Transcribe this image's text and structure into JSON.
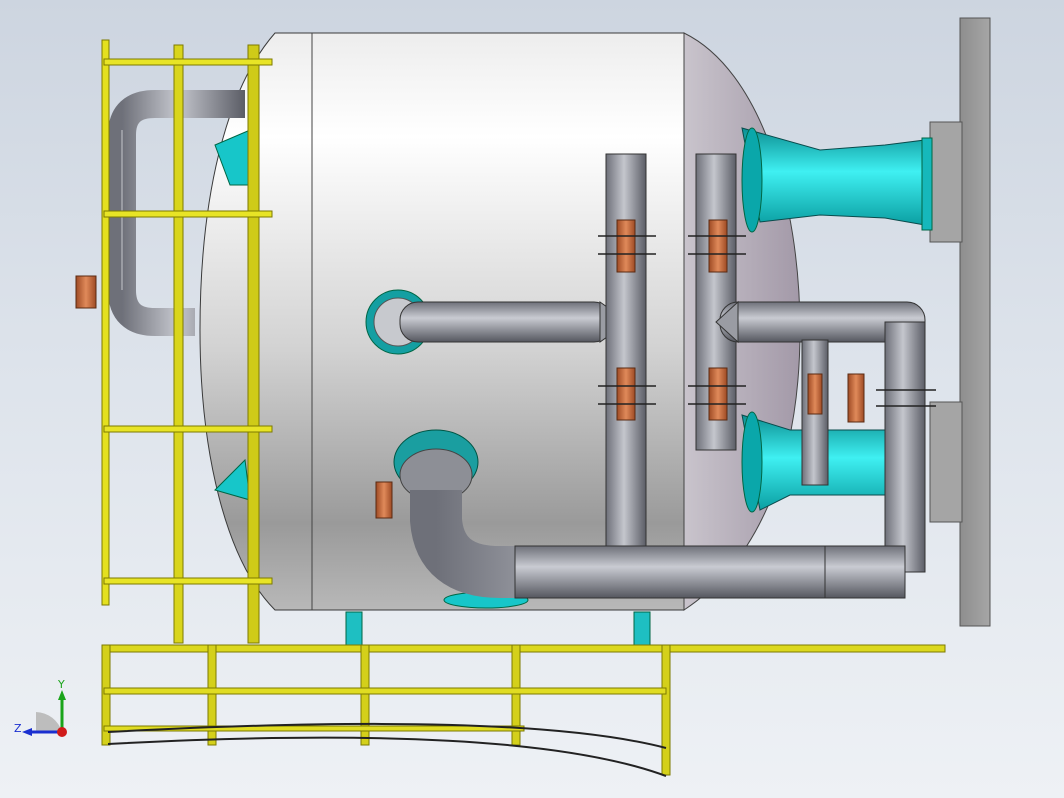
{
  "viewport": {
    "background_top": "#cdd5e0",
    "background_bottom": "#eef1f5"
  },
  "model": {
    "parts": [
      "pressure-vessel",
      "access-ladder",
      "handrail-platform",
      "process-piping",
      "flanged-nozzles",
      "actuated-valves",
      "support-frame"
    ],
    "colors": {
      "vessel": "#d9d9d9",
      "ladder": "#d6d21a",
      "nozzle": "#1fd3d6",
      "valve": "#c8683a",
      "pipe": "#8a8d96",
      "frame": "#9c9c9c"
    }
  },
  "triad": {
    "y_label": "Y",
    "z_label": "Z",
    "y_color": "#1aa41a",
    "z_color": "#1a2fd0",
    "x_color": "#d01a1a"
  }
}
